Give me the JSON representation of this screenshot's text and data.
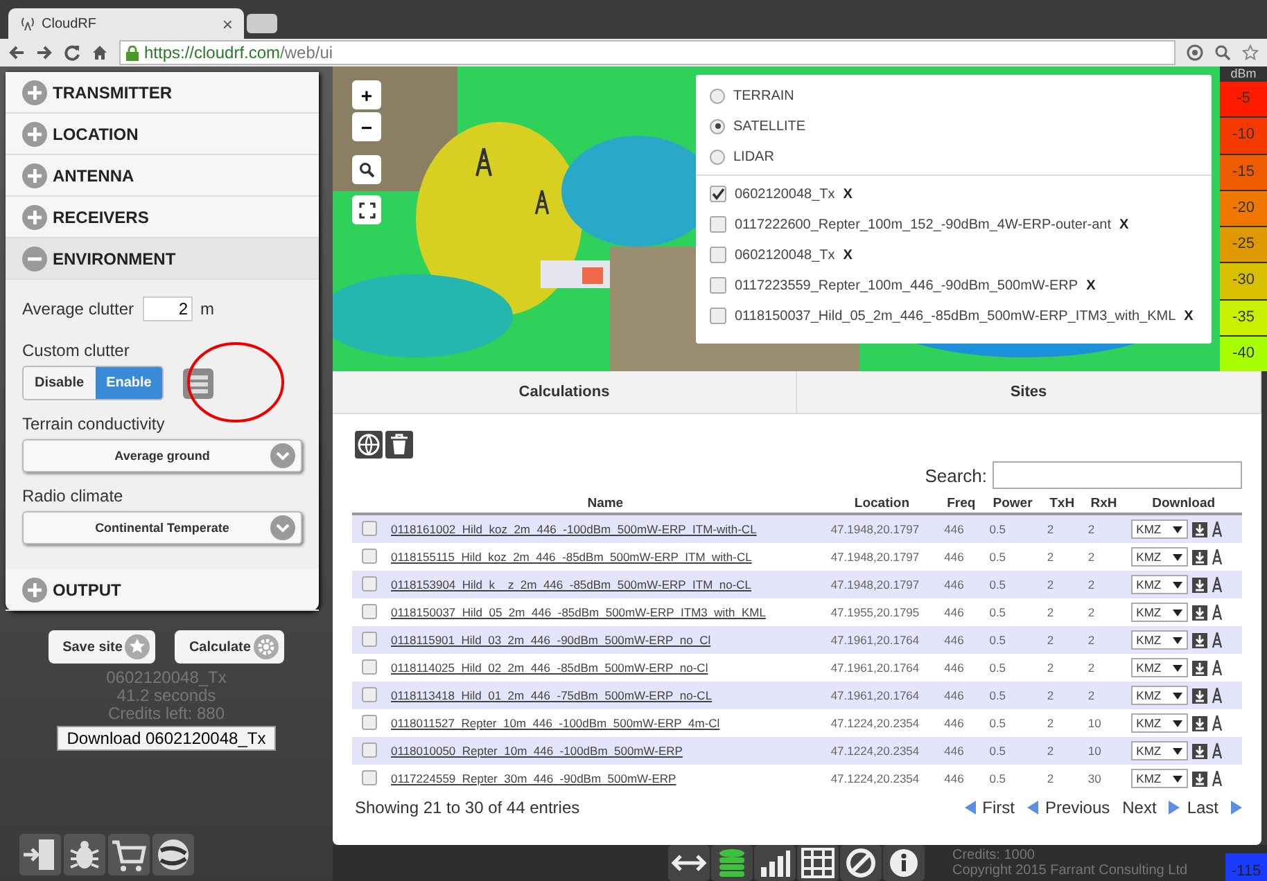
{
  "browser": {
    "tab_title": "CloudRF",
    "close": "×",
    "url_host": "https://cloudrf.com",
    "url_path": "/web/ui"
  },
  "sidebar": {
    "sections": [
      {
        "label": "TRANSMITTER",
        "expanded": false
      },
      {
        "label": "LOCATION",
        "expanded": false
      },
      {
        "label": "ANTENNA",
        "expanded": false
      },
      {
        "label": "RECEIVERS",
        "expanded": false
      },
      {
        "label": "ENVIRONMENT",
        "expanded": true,
        "fields": [
          {
            "kind": "number",
            "label": "Average clutter",
            "value": "2",
            "unit": "m"
          },
          {
            "kind": "toggle",
            "label": "Custom clutter",
            "options": [
              {
                "label": "Disable",
                "selected": false
              },
              {
                "label": "Enable",
                "selected": true
              }
            ]
          },
          {
            "kind": "select",
            "label": "Terrain conductivity",
            "value": "Average ground"
          },
          {
            "kind": "select",
            "label": "Radio climate",
            "value": "Continental Temperate"
          }
        ]
      },
      {
        "label": "OUTPUT",
        "expanded": false
      }
    ],
    "actions": [
      {
        "kind": "save",
        "label": "Save site"
      },
      {
        "kind": "calculate",
        "label": "Calculate"
      }
    ],
    "status": [
      "0602120048_Tx",
      "41.2 seconds",
      "Credits left: 880"
    ],
    "download": "Download 0602120048_Tx"
  },
  "map": {
    "zoom_controls": [
      "+",
      "−"
    ],
    "layers": [
      {
        "label": "TERRAIN",
        "selected": false
      },
      {
        "label": "SATELLITE",
        "selected": true
      },
      {
        "label": "LIDAR",
        "selected": false
      }
    ],
    "overlays": [
      {
        "label": "0602120048_Tx",
        "checked": true,
        "remove": "X"
      },
      {
        "label": "0117222600_Repter_100m_152_-90dBm_4W-ERP-outer-ant",
        "checked": false,
        "remove": "X"
      },
      {
        "label": "0602120048_Tx",
        "checked": false,
        "remove": "X"
      },
      {
        "label": "0117223559_Repter_100m_446_-90dBm_500mW-ERP",
        "checked": false,
        "remove": "X"
      },
      {
        "label": "0118150037_Hild_05_2m_446_-85dBm_500mW-ERP_ITM3_with_KML",
        "checked": false,
        "remove": "X"
      }
    ],
    "legend": {
      "unit": "dBm",
      "items": [
        {
          "label": "-5",
          "color": "#ff1a00"
        },
        {
          "label": "-10",
          "color": "#f53a00"
        },
        {
          "label": "-15",
          "color": "#f05a00"
        },
        {
          "label": "-20",
          "color": "#f07800"
        },
        {
          "label": "-25",
          "color": "#e09800"
        },
        {
          "label": "-30",
          "color": "#d8c000"
        },
        {
          "label": "-35",
          "color": "#c8f000"
        },
        {
          "label": "-40",
          "color": "#a8ff00"
        }
      ]
    }
  },
  "results": {
    "tabs": [
      {
        "label": "Calculations"
      },
      {
        "label": "Sites"
      }
    ],
    "search_label": "Search:",
    "columns": [
      "Name",
      "Location",
      "Freq",
      "Power",
      "TxH",
      "RxH",
      "Download"
    ],
    "rows": [
      {
        "checked": false,
        "name": "0118161002_Hild_koz_2m_446_-100dBm_500mW-ERP_ITM-with-CL",
        "location": "47.1948,20.1797",
        "freq": "446",
        "power": "0.5",
        "txh": "2",
        "rxh": "2",
        "format": "KMZ"
      },
      {
        "checked": false,
        "name": "0118155115_Hild_koz_2m_446_-85dBm_500mW-ERP_ITM_with-CL",
        "location": "47.1948,20.1797",
        "freq": "446",
        "power": "0.5",
        "txh": "2",
        "rxh": "2",
        "format": "KMZ"
      },
      {
        "checked": false,
        "name": "0118153904_Hild_k__z_2m_446_-85dBm_500mW-ERP_ITM_no-CL",
        "location": "47.1948,20.1797",
        "freq": "446",
        "power": "0.5",
        "txh": "2",
        "rxh": "2",
        "format": "KMZ"
      },
      {
        "checked": false,
        "name": "0118150037_Hild_05_2m_446_-85dBm_500mW-ERP_ITM3_with_KML",
        "location": "47.1955,20.1795",
        "freq": "446",
        "power": "0.5",
        "txh": "2",
        "rxh": "2",
        "format": "KMZ"
      },
      {
        "checked": false,
        "name": "0118115901_Hild_03_2m_446_-90dBm_500mW-ERP_no_Cl",
        "location": "47.1961,20.1764",
        "freq": "446",
        "power": "0.5",
        "txh": "2",
        "rxh": "2",
        "format": "KMZ"
      },
      {
        "checked": false,
        "name": "0118114025_Hild_02_2m_446_-85dBm_500mW-ERP_no-Cl",
        "location": "47.1961,20.1764",
        "freq": "446",
        "power": "0.5",
        "txh": "2",
        "rxh": "2",
        "format": "KMZ"
      },
      {
        "checked": false,
        "name": "0118113418_Hild_01_2m_446_-75dBm_500mW-ERP_no-CL",
        "location": "47.1961,20.1764",
        "freq": "446",
        "power": "0.5",
        "txh": "2",
        "rxh": "2",
        "format": "KMZ"
      },
      {
        "checked": false,
        "name": "0118011527_Repter_10m_446_-100dBm_500mW-ERP_4m-Cl",
        "location": "47.1224,20.2354",
        "freq": "446",
        "power": "0.5",
        "txh": "2",
        "rxh": "10",
        "format": "KMZ"
      },
      {
        "checked": false,
        "name": "0118010050_Repter_10m_446_-100dBm_500mW-ERP",
        "location": "47.1224,20.2354",
        "freq": "446",
        "power": "0.5",
        "txh": "2",
        "rxh": "10",
        "format": "KMZ"
      },
      {
        "checked": false,
        "name": "0117224559_Repter_30m_446_-90dBm_500mW-ERP",
        "location": "47.1224,20.2354",
        "freq": "446",
        "power": "0.5",
        "txh": "2",
        "rxh": "30",
        "format": "KMZ"
      }
    ],
    "info": "Showing 21 to 30 of 44 entries",
    "pager": [
      "First",
      "Previous",
      "Next",
      "Last"
    ]
  },
  "footer": {
    "credits": "Credits: 1000",
    "copyright": "Copyright 2015 Farrant Consulting Ltd",
    "legend_tail": {
      "label": "-115",
      "color": "#1a3cff"
    }
  }
}
